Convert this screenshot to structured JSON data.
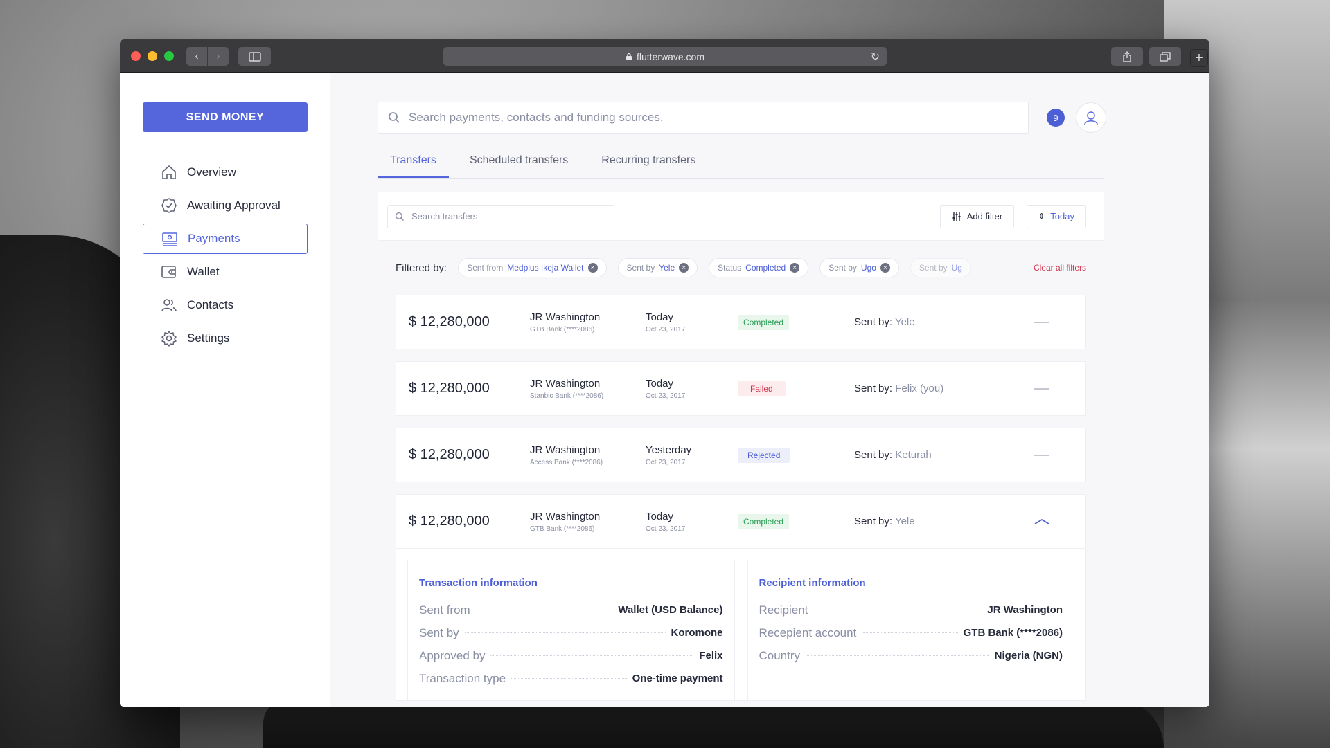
{
  "browser": {
    "url": "flutterwave.com"
  },
  "sidebar": {
    "send_money": "SEND MONEY",
    "items": [
      {
        "label": "Overview",
        "icon": "home-icon"
      },
      {
        "label": "Awaiting Approval",
        "icon": "badge-check-icon"
      },
      {
        "label": "Payments",
        "icon": "money-icon",
        "active": true
      },
      {
        "label": "Wallet",
        "icon": "wallet-icon"
      },
      {
        "label": "Contacts",
        "icon": "users-icon"
      },
      {
        "label": "Settings",
        "icon": "gear-icon"
      }
    ]
  },
  "header": {
    "search_placeholder": "Search payments, contacts and funding sources.",
    "notifications": "9"
  },
  "tabs": [
    "Transfers",
    "Scheduled transfers",
    "Recurring transfers"
  ],
  "toolbar": {
    "search_placeholder": "Search transfers",
    "add_filter": "Add filter",
    "sort": "Today"
  },
  "filters": {
    "label": "Filtered by:",
    "chips": [
      {
        "key": "Sent from",
        "value": "Medplus Ikeja Wallet"
      },
      {
        "key": "Sent by",
        "value": "Yele"
      },
      {
        "key": "Status",
        "value": "Completed"
      },
      {
        "key": "Sent by",
        "value": "Ugo"
      },
      {
        "key": "Sent by",
        "value": "Ug"
      }
    ],
    "clear_all": "Clear all filters"
  },
  "transfers": [
    {
      "amount": "$ 12,280,000",
      "name": "JR Washington",
      "bank": "GTB Bank (****2086)",
      "date": "Today",
      "date_sub": "Oct 23, 2017",
      "status": "Completed",
      "sent_by_label": "Sent by:",
      "sent_by": "Yele"
    },
    {
      "amount": "$ 12,280,000",
      "name": "JR Washington",
      "bank": "Stanbic Bank (****2086)",
      "date": "Today",
      "date_sub": "Oct 23, 2017",
      "status": "Failed",
      "sent_by_label": "Sent by:",
      "sent_by": "Felix (you)"
    },
    {
      "amount": "$ 12,280,000",
      "name": "JR Washington",
      "bank": "Access Bank (****2086)",
      "date": "Yesterday",
      "date_sub": "Oct 23, 2017",
      "status": "Rejected",
      "sent_by_label": "Sent by:",
      "sent_by": "Keturah"
    },
    {
      "amount": "$ 12,280,000",
      "name": "JR Washington",
      "bank": "GTB Bank (****2086)",
      "date": "Today",
      "date_sub": "Oct 23, 2017",
      "status": "Completed",
      "sent_by_label": "Sent by:",
      "sent_by": "Yele"
    }
  ],
  "transaction_info": {
    "title": "Transaction information",
    "rows": [
      {
        "key": "Sent from",
        "value": "Wallet (USD Balance)"
      },
      {
        "key": "Sent by",
        "value": "Koromone"
      },
      {
        "key": "Approved by",
        "value": "Felix"
      },
      {
        "key": "Transaction type",
        "value": "One-time payment"
      }
    ]
  },
  "recipient_info": {
    "title": "Recipient information",
    "rows": [
      {
        "key": "Recipient",
        "value": "JR Washington"
      },
      {
        "key": "Recepient account",
        "value": "GTB Bank (****2086)"
      },
      {
        "key": "Country",
        "value": "Nigeria (NGN)"
      }
    ]
  },
  "colors": {
    "accent": "#5566dd",
    "completed": "#2a9d55",
    "failed": "#d0344a",
    "rejected": "#4c5fd5"
  }
}
